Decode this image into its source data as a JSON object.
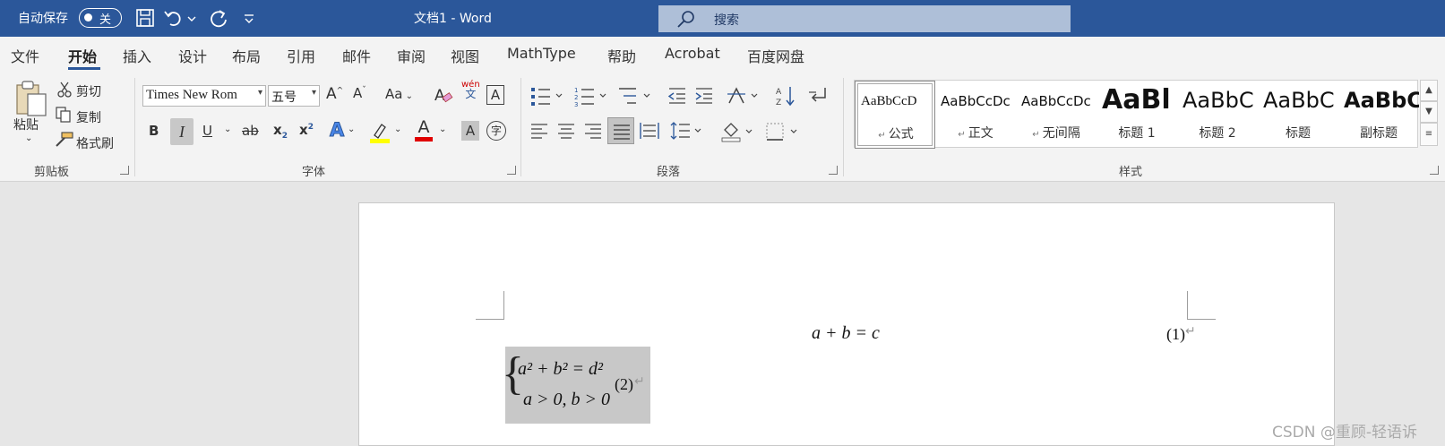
{
  "titlebar": {
    "autosave_label": "自动保存",
    "toggle_state": "关",
    "doc_title": "文档1 - Word",
    "search_placeholder": "搜索"
  },
  "menu": {
    "tabs": [
      "文件",
      "开始",
      "插入",
      "设计",
      "布局",
      "引用",
      "邮件",
      "审阅",
      "视图",
      "MathType",
      "帮助",
      "Acrobat",
      "百度网盘"
    ],
    "active": "开始"
  },
  "clipboard": {
    "paste": "粘贴",
    "cut": "剪切",
    "copy": "复制",
    "format_painter": "格式刷",
    "label": "剪贴板"
  },
  "font": {
    "name": "Times New Rom",
    "size": "五号",
    "case_label": "Aa",
    "phonetic_top": "wén",
    "phonetic_bottom": "文",
    "bold": "B",
    "italic": "I",
    "underline": "U",
    "strike": "ab",
    "subscript": "x",
    "superscript": "x",
    "sub_mark": "2",
    "sup_mark": "2",
    "effects": "A",
    "font_color": "A",
    "shading": "A",
    "enclose": "字",
    "label": "字体",
    "highlight_color": "#ffff00",
    "font_color_value": "#e00000"
  },
  "paragraph": {
    "label": "段落"
  },
  "styles": {
    "label": "样式",
    "items": [
      {
        "sample": "AaBbCcD",
        "name": "公式"
      },
      {
        "sample": "AaBbCcDc",
        "name": "正文"
      },
      {
        "sample": "AaBbCcDc",
        "name": "无间隔"
      },
      {
        "sample": "AaBl",
        "name": "标题 1"
      },
      {
        "sample": "AaBbC",
        "name": "标题 2"
      },
      {
        "sample": "AaBbC",
        "name": "标题"
      },
      {
        "sample": "AaBbC",
        "name": "副标题"
      }
    ]
  },
  "document": {
    "eq1": "a + b = c",
    "eq1_num": "(1)",
    "eq2_line1": "a² + b² = d²",
    "eq2_line2": "a > 0, b > 0",
    "eq2_num": "(2)",
    "para_mark": "↵"
  },
  "watermark": "CSDN @重顾-轻语诉"
}
